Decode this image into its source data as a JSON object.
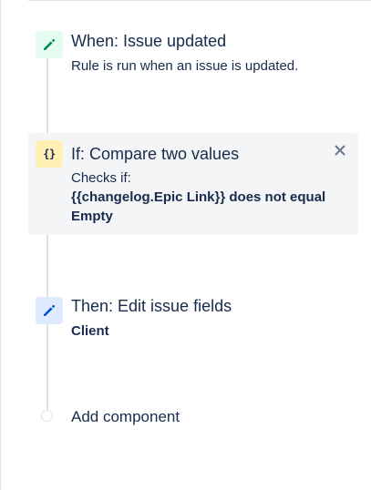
{
  "colors": {
    "trigger_icon": "#00875a",
    "trigger_icon_bg": "#e3fcef",
    "condition_icon_bg": "#fff0b3",
    "action_icon": "#0052cc",
    "action_icon_bg": "#deebff",
    "text": "#172b4d",
    "timeline": "#dfe1e6",
    "condition_bg": "#f4f5f7"
  },
  "trigger": {
    "icon": "pencil-icon",
    "title": "When: Issue updated",
    "description": "Rule is run when an issue is updated."
  },
  "condition": {
    "icon": "curly-braces-icon",
    "icon_text": "{}",
    "title": "If: Compare two values",
    "checks_label": "Checks if:",
    "expression": "{{changelog.Epic Link}} does not equal Empty",
    "close_icon": "close-icon"
  },
  "action": {
    "icon": "pencil-icon",
    "title": "Then: Edit issue fields",
    "field": "Client"
  },
  "add_component": {
    "label": "Add component"
  }
}
